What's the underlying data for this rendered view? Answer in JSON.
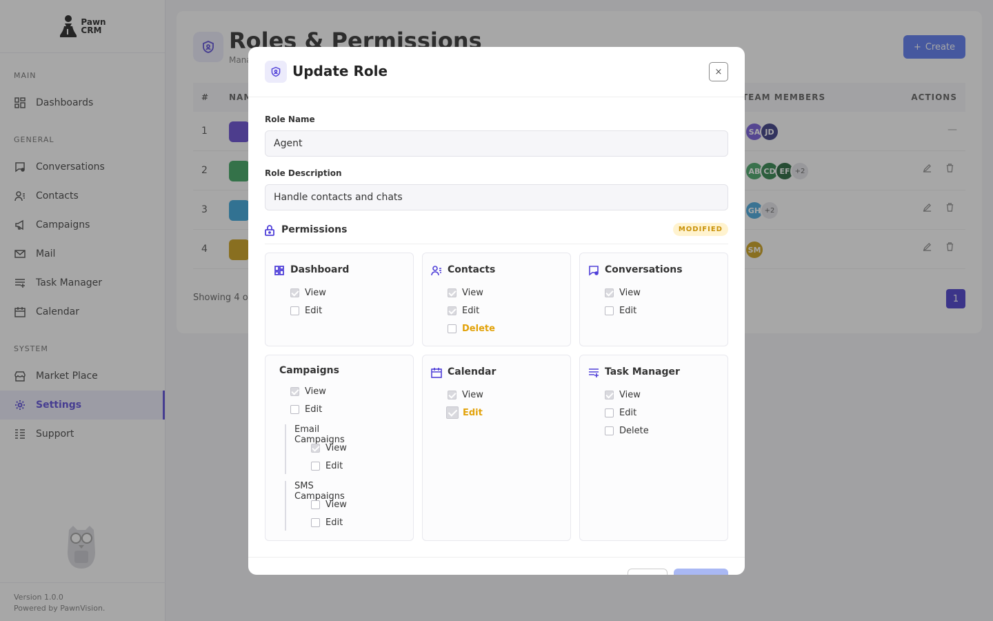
{
  "app": {
    "logo_line1": "Pawn",
    "logo_line2": "CRM",
    "version": "Version 1.0.0",
    "powered": "Powered by PawnVision."
  },
  "sidebar": {
    "sections": {
      "main": "MAIN",
      "general": "GENERAL",
      "system": "SYSTEM"
    },
    "items": [
      {
        "label": "Dashboards",
        "icon": "dashboard-icon"
      },
      {
        "label": "Conversations",
        "icon": "conversation-icon"
      },
      {
        "label": "Contacts",
        "icon": "contacts-icon"
      },
      {
        "label": "Campaigns",
        "icon": "megaphone-icon"
      },
      {
        "label": "Mail",
        "icon": "mail-icon"
      },
      {
        "label": "Task Manager",
        "icon": "task-icon"
      },
      {
        "label": "Calendar",
        "icon": "calendar-icon"
      },
      {
        "label": "Market Place",
        "icon": "store-icon"
      },
      {
        "label": "Settings",
        "icon": "gear-icon"
      },
      {
        "label": "Support",
        "icon": "support-icon"
      }
    ]
  },
  "page": {
    "title": "Roles & Permissions",
    "subtitle": "Mana",
    "create_label": "Create",
    "columns": {
      "num": "#",
      "name": "NAM",
      "members": "TEAM MEMBERS",
      "actions": "ACTIONS"
    },
    "rows": [
      {
        "num": "1",
        "badge_color": "#5b3fd0",
        "members": [
          {
            "initials": "SA",
            "color": "#6b4fd8"
          },
          {
            "initials": "JD",
            "color": "#2b2c7a"
          }
        ],
        "more": "",
        "actions": "—"
      },
      {
        "num": "2",
        "badge_color": "#2f9e55",
        "members": [
          {
            "initials": "AB",
            "color": "#3a9e5b"
          },
          {
            "initials": "CD",
            "color": "#1f7a3e"
          },
          {
            "initials": "EF",
            "color": "#145a2c"
          }
        ],
        "more": "+2",
        "actions": ""
      },
      {
        "num": "3",
        "badge_color": "#2b9fd9",
        "members": [
          {
            "initials": "GH",
            "color": "#3aa0db"
          }
        ],
        "more": "+2",
        "actions": ""
      },
      {
        "num": "4",
        "badge_color": "#c99a0a",
        "members": [
          {
            "initials": "SM",
            "color": "#c99a0a"
          }
        ],
        "more": "",
        "actions": ""
      }
    ],
    "showing": "Showing 4 of",
    "pagination_current": "1"
  },
  "modal": {
    "title": "Update Role",
    "close": "×",
    "role_name_label": "Role Name",
    "role_name_value": "Agent",
    "role_desc_label": "Role Description",
    "role_desc_value": "Handle contacts and chats",
    "permissions_label": "Permissions",
    "modified_badge": "MODIFIED",
    "cards": {
      "dashboard": {
        "title": "Dashboard",
        "view": "View",
        "edit": "Edit"
      },
      "contacts": {
        "title": "Contacts",
        "view": "View",
        "edit": "Edit",
        "delete": "Delete"
      },
      "conversations": {
        "title": "Conversations",
        "view": "View",
        "edit": "Edit"
      },
      "campaigns": {
        "title": "Campaigns",
        "view": "View",
        "edit": "Edit",
        "email": {
          "title": "Email Campaigns",
          "view": "View",
          "edit": "Edit"
        },
        "sms": {
          "title": "SMS Campaigns",
          "view": "View",
          "edit": "Edit"
        }
      },
      "calendar": {
        "title": "Calendar",
        "view": "View",
        "edit": "Edit"
      },
      "task_manager": {
        "title": "Task Manager",
        "view": "View",
        "edit": "Edit",
        "delete": "Delete"
      }
    }
  },
  "colors": {
    "accent": "#4f3fd8",
    "modified": "#e2a20a"
  }
}
